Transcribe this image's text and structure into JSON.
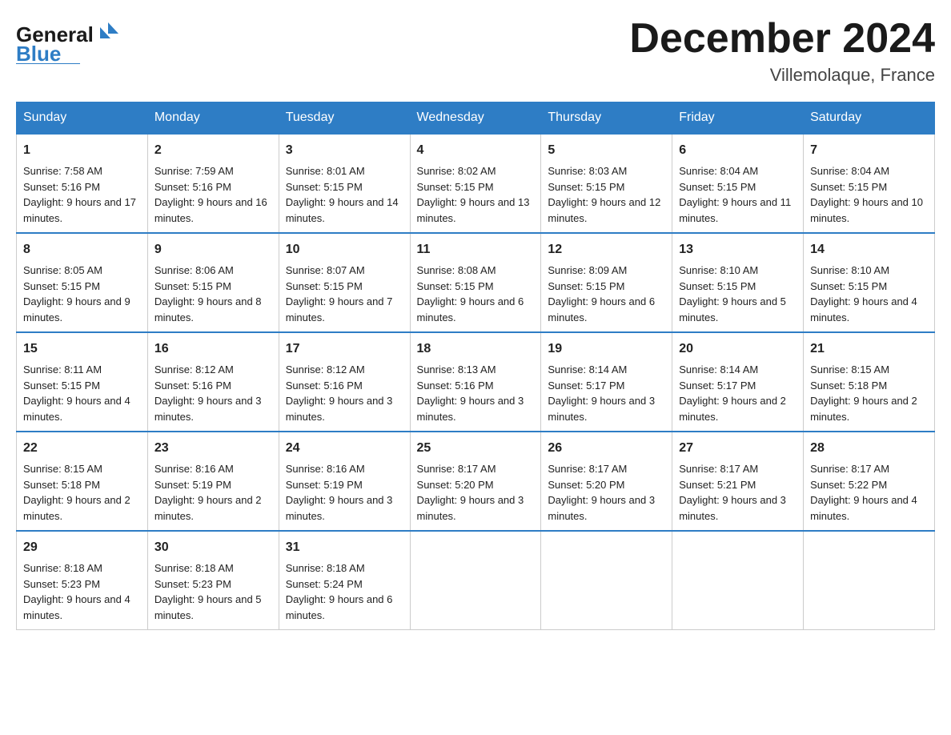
{
  "header": {
    "logo_general": "General",
    "logo_blue": "Blue",
    "month_title": "December 2024",
    "location": "Villemolaque, France"
  },
  "weekdays": [
    "Sunday",
    "Monday",
    "Tuesday",
    "Wednesday",
    "Thursday",
    "Friday",
    "Saturday"
  ],
  "weeks": [
    [
      {
        "day": "1",
        "sunrise": "7:58 AM",
        "sunset": "5:16 PM",
        "daylight": "9 hours and 17 minutes."
      },
      {
        "day": "2",
        "sunrise": "7:59 AM",
        "sunset": "5:16 PM",
        "daylight": "9 hours and 16 minutes."
      },
      {
        "day": "3",
        "sunrise": "8:01 AM",
        "sunset": "5:15 PM",
        "daylight": "9 hours and 14 minutes."
      },
      {
        "day": "4",
        "sunrise": "8:02 AM",
        "sunset": "5:15 PM",
        "daylight": "9 hours and 13 minutes."
      },
      {
        "day": "5",
        "sunrise": "8:03 AM",
        "sunset": "5:15 PM",
        "daylight": "9 hours and 12 minutes."
      },
      {
        "day": "6",
        "sunrise": "8:04 AM",
        "sunset": "5:15 PM",
        "daylight": "9 hours and 11 minutes."
      },
      {
        "day": "7",
        "sunrise": "8:04 AM",
        "sunset": "5:15 PM",
        "daylight": "9 hours and 10 minutes."
      }
    ],
    [
      {
        "day": "8",
        "sunrise": "8:05 AM",
        "sunset": "5:15 PM",
        "daylight": "9 hours and 9 minutes."
      },
      {
        "day": "9",
        "sunrise": "8:06 AM",
        "sunset": "5:15 PM",
        "daylight": "9 hours and 8 minutes."
      },
      {
        "day": "10",
        "sunrise": "8:07 AM",
        "sunset": "5:15 PM",
        "daylight": "9 hours and 7 minutes."
      },
      {
        "day": "11",
        "sunrise": "8:08 AM",
        "sunset": "5:15 PM",
        "daylight": "9 hours and 6 minutes."
      },
      {
        "day": "12",
        "sunrise": "8:09 AM",
        "sunset": "5:15 PM",
        "daylight": "9 hours and 6 minutes."
      },
      {
        "day": "13",
        "sunrise": "8:10 AM",
        "sunset": "5:15 PM",
        "daylight": "9 hours and 5 minutes."
      },
      {
        "day": "14",
        "sunrise": "8:10 AM",
        "sunset": "5:15 PM",
        "daylight": "9 hours and 4 minutes."
      }
    ],
    [
      {
        "day": "15",
        "sunrise": "8:11 AM",
        "sunset": "5:15 PM",
        "daylight": "9 hours and 4 minutes."
      },
      {
        "day": "16",
        "sunrise": "8:12 AM",
        "sunset": "5:16 PM",
        "daylight": "9 hours and 3 minutes."
      },
      {
        "day": "17",
        "sunrise": "8:12 AM",
        "sunset": "5:16 PM",
        "daylight": "9 hours and 3 minutes."
      },
      {
        "day": "18",
        "sunrise": "8:13 AM",
        "sunset": "5:16 PM",
        "daylight": "9 hours and 3 minutes."
      },
      {
        "day": "19",
        "sunrise": "8:14 AM",
        "sunset": "5:17 PM",
        "daylight": "9 hours and 3 minutes."
      },
      {
        "day": "20",
        "sunrise": "8:14 AM",
        "sunset": "5:17 PM",
        "daylight": "9 hours and 2 minutes."
      },
      {
        "day": "21",
        "sunrise": "8:15 AM",
        "sunset": "5:18 PM",
        "daylight": "9 hours and 2 minutes."
      }
    ],
    [
      {
        "day": "22",
        "sunrise": "8:15 AM",
        "sunset": "5:18 PM",
        "daylight": "9 hours and 2 minutes."
      },
      {
        "day": "23",
        "sunrise": "8:16 AM",
        "sunset": "5:19 PM",
        "daylight": "9 hours and 2 minutes."
      },
      {
        "day": "24",
        "sunrise": "8:16 AM",
        "sunset": "5:19 PM",
        "daylight": "9 hours and 3 minutes."
      },
      {
        "day": "25",
        "sunrise": "8:17 AM",
        "sunset": "5:20 PM",
        "daylight": "9 hours and 3 minutes."
      },
      {
        "day": "26",
        "sunrise": "8:17 AM",
        "sunset": "5:20 PM",
        "daylight": "9 hours and 3 minutes."
      },
      {
        "day": "27",
        "sunrise": "8:17 AM",
        "sunset": "5:21 PM",
        "daylight": "9 hours and 3 minutes."
      },
      {
        "day": "28",
        "sunrise": "8:17 AM",
        "sunset": "5:22 PM",
        "daylight": "9 hours and 4 minutes."
      }
    ],
    [
      {
        "day": "29",
        "sunrise": "8:18 AM",
        "sunset": "5:23 PM",
        "daylight": "9 hours and 4 minutes."
      },
      {
        "day": "30",
        "sunrise": "8:18 AM",
        "sunset": "5:23 PM",
        "daylight": "9 hours and 5 minutes."
      },
      {
        "day": "31",
        "sunrise": "8:18 AM",
        "sunset": "5:24 PM",
        "daylight": "9 hours and 6 minutes."
      },
      null,
      null,
      null,
      null
    ]
  ]
}
